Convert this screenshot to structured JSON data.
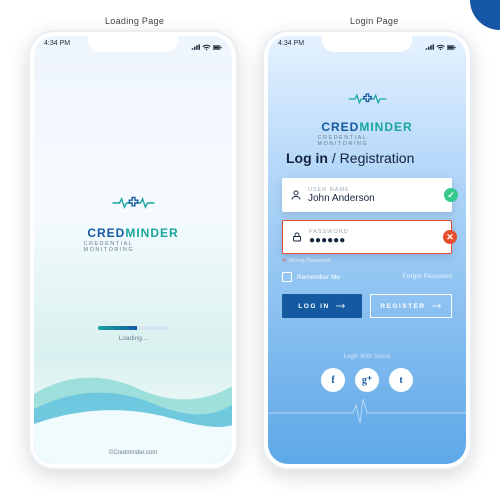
{
  "labels": {
    "loading_page": "Loading Page",
    "login_page": "Login Page"
  },
  "statusbar": {
    "time": "4:34 PM"
  },
  "brand": {
    "part1": "CRED",
    "part2": "MINDER",
    "tagline": "CREDENTIAL MONITORING"
  },
  "loading": {
    "progress_pct": 55,
    "label": "Loading...",
    "footer_url": "©Credminder.com"
  },
  "login": {
    "title_main": "Log in",
    "title_sep": " / ",
    "title_sub": "Registration",
    "username": {
      "label": "USER NAME",
      "value": "John Anderson",
      "valid": true
    },
    "password": {
      "label": "PASSWORD",
      "value": "●●●●●●",
      "valid": false
    },
    "error_msg": "Wrong Password",
    "remember": "Remember Me",
    "forgot": "Forgot Password",
    "login_btn": "LOG IN",
    "register_btn": "REGISTER",
    "social_label": "Login With Social",
    "social": {
      "fb": "f",
      "g": "g⁺",
      "tw": "t"
    }
  },
  "colors": {
    "primary": "#145aa0",
    "accent": "#1aa59f",
    "error": "#e84e2e",
    "success": "#36c98e"
  }
}
